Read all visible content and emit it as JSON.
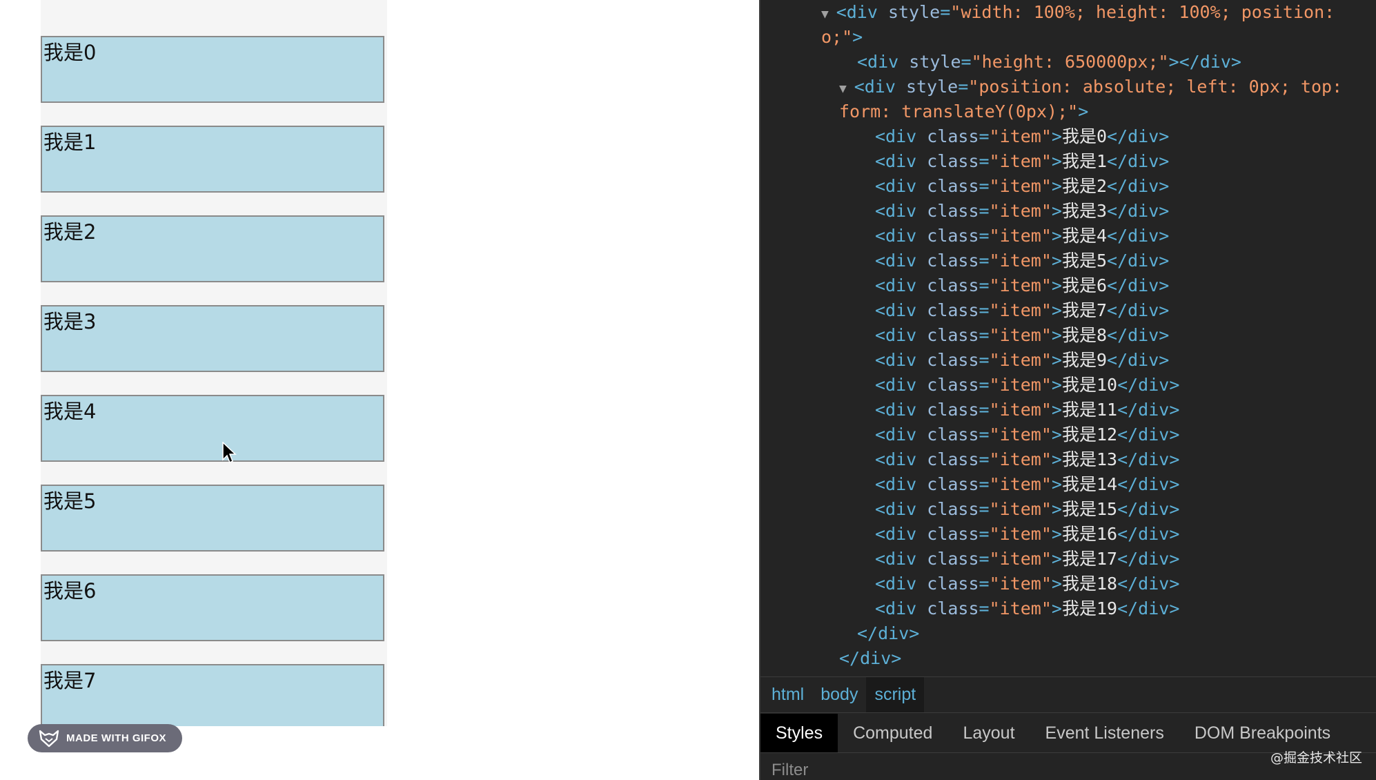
{
  "page": {
    "items": [
      "我是0",
      "我是1",
      "我是2",
      "我是3",
      "我是4",
      "我是5",
      "我是6",
      "我是7"
    ]
  },
  "gifox_badge": {
    "label": "MADE WITH GIFOX"
  },
  "devtools": {
    "code_lines": [
      {
        "indent": 0,
        "arrow": true,
        "parts": [
          [
            "tag",
            "<div "
          ],
          [
            "attr",
            "style"
          ],
          [
            "tag",
            "="
          ],
          [
            "val",
            "\"width: 100%; height: 100%; position:"
          ]
        ]
      },
      {
        "indent": 0,
        "arrow": false,
        "parts": [
          [
            "val",
            "o;\""
          ],
          [
            "tag",
            ">"
          ]
        ]
      },
      {
        "indent": 1,
        "arrow": false,
        "parts": [
          [
            "tag",
            "<div "
          ],
          [
            "attr",
            "style"
          ],
          [
            "tag",
            "="
          ],
          [
            "val",
            "\"height: 650000px;\""
          ],
          [
            "tag",
            "></div>"
          ]
        ]
      },
      {
        "indent": 1,
        "arrow": true,
        "parts": [
          [
            "tag",
            "<div "
          ],
          [
            "attr",
            "style"
          ],
          [
            "tag",
            "="
          ],
          [
            "val",
            "\"position: absolute; left: 0px; top:"
          ]
        ]
      },
      {
        "indent": 1,
        "arrow": false,
        "parts": [
          [
            "val",
            "form: translateY(0px);\""
          ],
          [
            "tag",
            ">"
          ]
        ]
      },
      {
        "indent": 2,
        "arrow": false,
        "parts": [
          [
            "tag",
            "<div "
          ],
          [
            "attr",
            "class"
          ],
          [
            "tag",
            "="
          ],
          [
            "val",
            "\"item\""
          ],
          [
            "tag",
            ">"
          ],
          [
            "txt",
            "我是0"
          ],
          [
            "tag",
            "</div>"
          ]
        ]
      },
      {
        "indent": 2,
        "arrow": false,
        "parts": [
          [
            "tag",
            "<div "
          ],
          [
            "attr",
            "class"
          ],
          [
            "tag",
            "="
          ],
          [
            "val",
            "\"item\""
          ],
          [
            "tag",
            ">"
          ],
          [
            "txt",
            "我是1"
          ],
          [
            "tag",
            "</div>"
          ]
        ]
      },
      {
        "indent": 2,
        "arrow": false,
        "parts": [
          [
            "tag",
            "<div "
          ],
          [
            "attr",
            "class"
          ],
          [
            "tag",
            "="
          ],
          [
            "val",
            "\"item\""
          ],
          [
            "tag",
            ">"
          ],
          [
            "txt",
            "我是2"
          ],
          [
            "tag",
            "</div>"
          ]
        ]
      },
      {
        "indent": 2,
        "arrow": false,
        "parts": [
          [
            "tag",
            "<div "
          ],
          [
            "attr",
            "class"
          ],
          [
            "tag",
            "="
          ],
          [
            "val",
            "\"item\""
          ],
          [
            "tag",
            ">"
          ],
          [
            "txt",
            "我是3"
          ],
          [
            "tag",
            "</div>"
          ]
        ]
      },
      {
        "indent": 2,
        "arrow": false,
        "parts": [
          [
            "tag",
            "<div "
          ],
          [
            "attr",
            "class"
          ],
          [
            "tag",
            "="
          ],
          [
            "val",
            "\"item\""
          ],
          [
            "tag",
            ">"
          ],
          [
            "txt",
            "我是4"
          ],
          [
            "tag",
            "</div>"
          ]
        ]
      },
      {
        "indent": 2,
        "arrow": false,
        "parts": [
          [
            "tag",
            "<div "
          ],
          [
            "attr",
            "class"
          ],
          [
            "tag",
            "="
          ],
          [
            "val",
            "\"item\""
          ],
          [
            "tag",
            ">"
          ],
          [
            "txt",
            "我是5"
          ],
          [
            "tag",
            "</div>"
          ]
        ]
      },
      {
        "indent": 2,
        "arrow": false,
        "parts": [
          [
            "tag",
            "<div "
          ],
          [
            "attr",
            "class"
          ],
          [
            "tag",
            "="
          ],
          [
            "val",
            "\"item\""
          ],
          [
            "tag",
            ">"
          ],
          [
            "txt",
            "我是6"
          ],
          [
            "tag",
            "</div>"
          ]
        ]
      },
      {
        "indent": 2,
        "arrow": false,
        "parts": [
          [
            "tag",
            "<div "
          ],
          [
            "attr",
            "class"
          ],
          [
            "tag",
            "="
          ],
          [
            "val",
            "\"item\""
          ],
          [
            "tag",
            ">"
          ],
          [
            "txt",
            "我是7"
          ],
          [
            "tag",
            "</div>"
          ]
        ]
      },
      {
        "indent": 2,
        "arrow": false,
        "parts": [
          [
            "tag",
            "<div "
          ],
          [
            "attr",
            "class"
          ],
          [
            "tag",
            "="
          ],
          [
            "val",
            "\"item\""
          ],
          [
            "tag",
            ">"
          ],
          [
            "txt",
            "我是8"
          ],
          [
            "tag",
            "</div>"
          ]
        ]
      },
      {
        "indent": 2,
        "arrow": false,
        "parts": [
          [
            "tag",
            "<div "
          ],
          [
            "attr",
            "class"
          ],
          [
            "tag",
            "="
          ],
          [
            "val",
            "\"item\""
          ],
          [
            "tag",
            ">"
          ],
          [
            "txt",
            "我是9"
          ],
          [
            "tag",
            "</div>"
          ]
        ]
      },
      {
        "indent": 2,
        "arrow": false,
        "parts": [
          [
            "tag",
            "<div "
          ],
          [
            "attr",
            "class"
          ],
          [
            "tag",
            "="
          ],
          [
            "val",
            "\"item\""
          ],
          [
            "tag",
            ">"
          ],
          [
            "txt",
            "我是10"
          ],
          [
            "tag",
            "</div>"
          ]
        ]
      },
      {
        "indent": 2,
        "arrow": false,
        "parts": [
          [
            "tag",
            "<div "
          ],
          [
            "attr",
            "class"
          ],
          [
            "tag",
            "="
          ],
          [
            "val",
            "\"item\""
          ],
          [
            "tag",
            ">"
          ],
          [
            "txt",
            "我是11"
          ],
          [
            "tag",
            "</div>"
          ]
        ]
      },
      {
        "indent": 2,
        "arrow": false,
        "parts": [
          [
            "tag",
            "<div "
          ],
          [
            "attr",
            "class"
          ],
          [
            "tag",
            "="
          ],
          [
            "val",
            "\"item\""
          ],
          [
            "tag",
            ">"
          ],
          [
            "txt",
            "我是12"
          ],
          [
            "tag",
            "</div>"
          ]
        ]
      },
      {
        "indent": 2,
        "arrow": false,
        "parts": [
          [
            "tag",
            "<div "
          ],
          [
            "attr",
            "class"
          ],
          [
            "tag",
            "="
          ],
          [
            "val",
            "\"item\""
          ],
          [
            "tag",
            ">"
          ],
          [
            "txt",
            "我是13"
          ],
          [
            "tag",
            "</div>"
          ]
        ]
      },
      {
        "indent": 2,
        "arrow": false,
        "parts": [
          [
            "tag",
            "<div "
          ],
          [
            "attr",
            "class"
          ],
          [
            "tag",
            "="
          ],
          [
            "val",
            "\"item\""
          ],
          [
            "tag",
            ">"
          ],
          [
            "txt",
            "我是14"
          ],
          [
            "tag",
            "</div>"
          ]
        ]
      },
      {
        "indent": 2,
        "arrow": false,
        "parts": [
          [
            "tag",
            "<div "
          ],
          [
            "attr",
            "class"
          ],
          [
            "tag",
            "="
          ],
          [
            "val",
            "\"item\""
          ],
          [
            "tag",
            ">"
          ],
          [
            "txt",
            "我是15"
          ],
          [
            "tag",
            "</div>"
          ]
        ]
      },
      {
        "indent": 2,
        "arrow": false,
        "parts": [
          [
            "tag",
            "<div "
          ],
          [
            "attr",
            "class"
          ],
          [
            "tag",
            "="
          ],
          [
            "val",
            "\"item\""
          ],
          [
            "tag",
            ">"
          ],
          [
            "txt",
            "我是16"
          ],
          [
            "tag",
            "</div>"
          ]
        ]
      },
      {
        "indent": 2,
        "arrow": false,
        "parts": [
          [
            "tag",
            "<div "
          ],
          [
            "attr",
            "class"
          ],
          [
            "tag",
            "="
          ],
          [
            "val",
            "\"item\""
          ],
          [
            "tag",
            ">"
          ],
          [
            "txt",
            "我是17"
          ],
          [
            "tag",
            "</div>"
          ]
        ]
      },
      {
        "indent": 2,
        "arrow": false,
        "parts": [
          [
            "tag",
            "<div "
          ],
          [
            "attr",
            "class"
          ],
          [
            "tag",
            "="
          ],
          [
            "val",
            "\"item\""
          ],
          [
            "tag",
            ">"
          ],
          [
            "txt",
            "我是18"
          ],
          [
            "tag",
            "</div>"
          ]
        ]
      },
      {
        "indent": 2,
        "arrow": false,
        "parts": [
          [
            "tag",
            "<div "
          ],
          [
            "attr",
            "class"
          ],
          [
            "tag",
            "="
          ],
          [
            "val",
            "\"item\""
          ],
          [
            "tag",
            ">"
          ],
          [
            "txt",
            "我是19"
          ],
          [
            "tag",
            "</div>"
          ]
        ]
      },
      {
        "indent": 1,
        "arrow": false,
        "parts": [
          [
            "tag",
            "</div>"
          ]
        ]
      },
      {
        "indent": 0,
        "arrow": false,
        "parts": [
          [
            "tag",
            "</div>"
          ]
        ]
      }
    ],
    "breadcrumbs": [
      "html",
      "body",
      "script"
    ],
    "active_breadcrumb": "script",
    "tabs": [
      "Styles",
      "Computed",
      "Layout",
      "Event Listeners",
      "DOM Breakpoints"
    ],
    "active_tab": "Styles",
    "filter_placeholder": "Filter",
    "watermark": "@掘金技术社区"
  }
}
